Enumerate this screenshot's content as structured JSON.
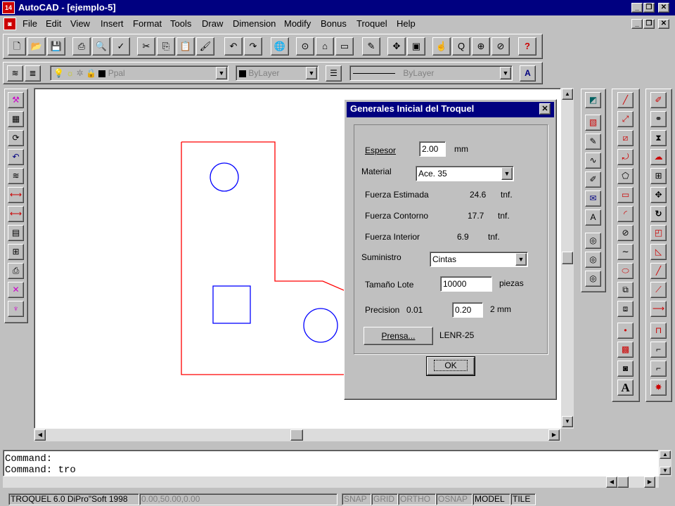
{
  "window": {
    "title": "AutoCAD - [ejemplo-5]",
    "app_icon_text": "14"
  },
  "menu": [
    "File",
    "Edit",
    "View",
    "Insert",
    "Format",
    "Tools",
    "Draw",
    "Dimension",
    "Modify",
    "Bonus",
    "Troquel",
    "Help"
  ],
  "layer_toolbar": {
    "layer_name": "Ppal",
    "color": "ByLayer",
    "linetype": "ByLayer"
  },
  "dialog": {
    "title": "Generales Inicial del Troquel",
    "espesor_label": "Espesor",
    "espesor_value": "2.00",
    "espesor_unit": "mm",
    "material_label": "Material",
    "material_value": "Ace. 35",
    "fuerza_estimada_label": "Fuerza Estimada",
    "fuerza_estimada_value": "24.6",
    "fuerza_estimada_unit": "tnf.",
    "fuerza_contorno_label": "Fuerza Contorno",
    "fuerza_contorno_value": "17.7",
    "fuerza_contorno_unit": "tnf.",
    "fuerza_interior_label": "Fuerza Interior",
    "fuerza_interior_value": "6.9",
    "fuerza_interior_unit": "tnf.",
    "suministro_label": "Suministro",
    "suministro_value": "Cintas",
    "tamano_label": "Tamaño Lote",
    "tamano_value": "10000",
    "tamano_unit": "piezas",
    "precision_label": "Precision",
    "precision_min": "0.01",
    "precision_value": "0.20",
    "precision_max": "2 mm",
    "prensa_button": "Prensa...",
    "prensa_value": "LENR-25",
    "ok_button": "OK"
  },
  "command": {
    "lines": "Command:\nCommand: tro"
  },
  "status": {
    "product": "TROQUEL 6.0 DiPro\"Soft 1998",
    "coords": "0.00,50.00,0.00",
    "snap": "SNAP",
    "grid": "GRID",
    "ortho": "ORTHO",
    "osnap": "OSNAP",
    "model": "MODEL",
    "tile": "TILE"
  },
  "colors": {
    "title_bg": "#000080",
    "drawing_contour": "#ff0000",
    "drawing_holes": "#0000ff"
  }
}
